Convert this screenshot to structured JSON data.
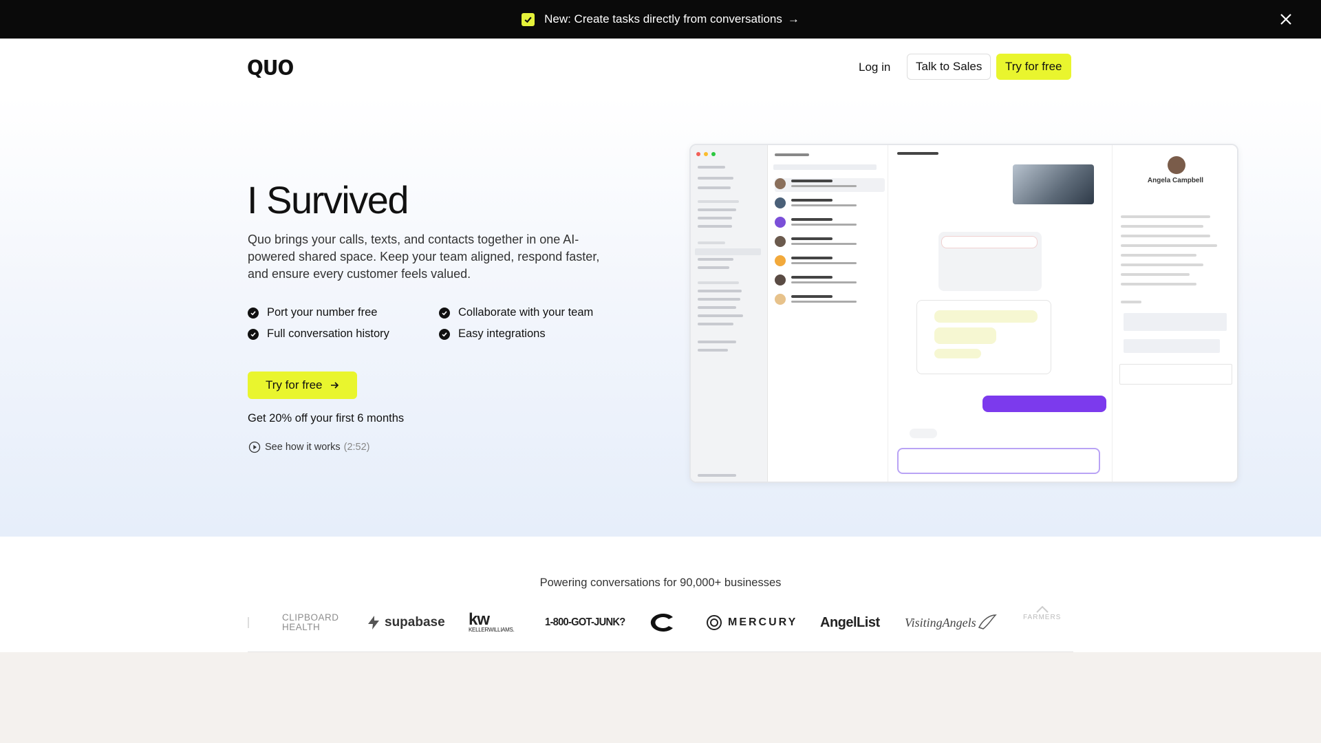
{
  "announcement": {
    "text": "New: Create tasks directly from conversations",
    "arrow": "→"
  },
  "header": {
    "logo": "QUO",
    "login": "Log in",
    "talk_to_sales": "Talk to Sales",
    "try_free": "Try for free"
  },
  "hero": {
    "title": "I Survived",
    "description": "Quo brings your calls, texts, and contacts together in one AI-powered shared space. Keep your team aligned, respond faster, and ensure every customer feels valued.",
    "features": [
      "Port your number free",
      "Collaborate with your team",
      "Full conversation history",
      "Easy integrations"
    ],
    "cta": "Try for free",
    "discount": "Get 20% off your first 6 months",
    "how_it_works": "See how it works",
    "how_duration": "(2:52)"
  },
  "preview": {
    "contact_name": "Angela Campbell"
  },
  "logos": {
    "heading": "Powering conversations for 90,000+ businesses",
    "items": {
      "clipboard_1": "CLIPBOARD",
      "clipboard_2": "HEALTH",
      "supabase": "supabase",
      "kw": "kw",
      "kw_sub": "KELLERWILLIAMS.",
      "junk": "1-800-GOT-JUNK?",
      "mercury": "MERCURY",
      "angellist": "AngelList",
      "visiting": "VisitingAngels",
      "farmers": "FARMERS"
    }
  },
  "colors": {
    "accent": "#e9f52e",
    "dark": "#0a0a0a"
  }
}
